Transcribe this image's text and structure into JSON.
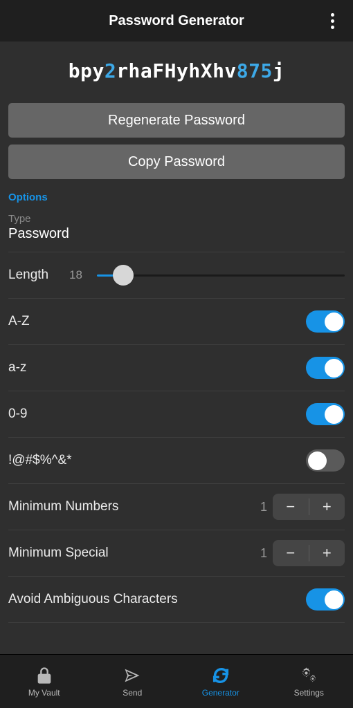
{
  "header": {
    "title": "Password Generator"
  },
  "password": {
    "segments": [
      {
        "t": "bpy",
        "k": "l"
      },
      {
        "t": "2",
        "k": "d"
      },
      {
        "t": "rhaFHyhXhv",
        "k": "l"
      },
      {
        "t": "875",
        "k": "d"
      },
      {
        "t": "j",
        "k": "l"
      }
    ]
  },
  "buttons": {
    "regenerate": "Regenerate Password",
    "copy": "Copy Password"
  },
  "options": {
    "header": "Options",
    "type_label": "Type",
    "type_value": "Password",
    "length_label": "Length",
    "length_value": "18",
    "length_min": 5,
    "length_max": 128,
    "uppercase_label": "A-Z",
    "lowercase_label": "a-z",
    "digits_label": "0-9",
    "special_label": "!@#$%^&*",
    "min_numbers_label": "Minimum Numbers",
    "min_numbers_value": "1",
    "min_special_label": "Minimum Special",
    "min_special_value": "1",
    "avoid_label": "Avoid Ambiguous Characters",
    "toggles": {
      "upper": true,
      "lower": true,
      "digits": true,
      "special": false,
      "avoid": true
    }
  },
  "tabs": [
    {
      "id": "vault",
      "label": "My Vault"
    },
    {
      "id": "send",
      "label": "Send"
    },
    {
      "id": "generator",
      "label": "Generator"
    },
    {
      "id": "settings",
      "label": "Settings"
    }
  ],
  "active_tab": "generator",
  "colors": {
    "accent": "#1793e6",
    "bg": "#2f2f2f",
    "bar": "#1f1f1f"
  }
}
